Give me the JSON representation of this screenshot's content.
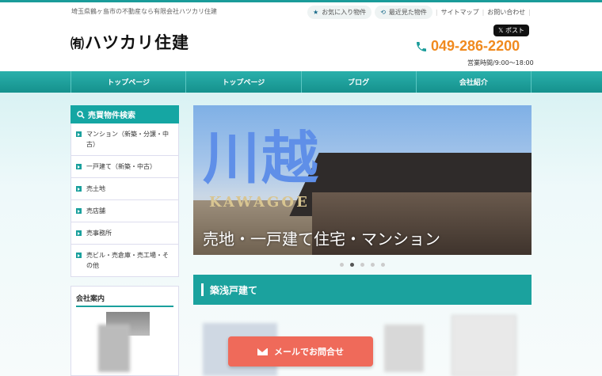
{
  "header": {
    "tagline": "埼玉県鶴ヶ島市の不動産なら有限会社ハツカリ住建",
    "logo_mark": "㈲",
    "logo_text": "ハツカリ住建",
    "links": {
      "favorites": "お気に入り物件",
      "recent": "最近見た物件",
      "sitemap": "サイトマップ",
      "contact": "お問い合わせ"
    },
    "x_post": "𝕏 ポスト",
    "phone": "049-286-2200",
    "hours": "営業時間/9:00～18:00"
  },
  "nav": [
    {
      "label": "トップページ"
    },
    {
      "label": "トップページ"
    },
    {
      "label": "ブログ"
    },
    {
      "label": "会社紹介"
    }
  ],
  "sidebar": {
    "title": "売買物件検索",
    "items": [
      {
        "label": "マンション（新築・分譲・中古）"
      },
      {
        "label": "一戸建て（新築・中古）"
      },
      {
        "label": "売土地"
      },
      {
        "label": "売店舗"
      },
      {
        "label": "売事務所"
      },
      {
        "label": "売ビル・売倉庫・売工場・その他"
      }
    ],
    "company_title": "会社案内"
  },
  "slider": {
    "big_text": "川越",
    "romaji": "KAWAGOE",
    "caption": "売地・一戸建て住宅・マンション",
    "dot_count": 5,
    "active_dot": 1
  },
  "section": {
    "title": "築浅戸建て"
  },
  "cta": {
    "label": "メールでお問合せ"
  },
  "colors": {
    "accent": "#1aa09d",
    "phone": "#f08a1f",
    "cta": "#ef6a5a"
  }
}
